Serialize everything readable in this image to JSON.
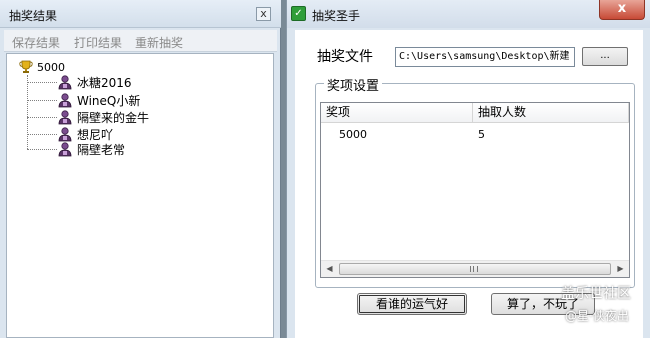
{
  "left_window": {
    "title": "抽奖结果",
    "close_label": "x",
    "menu": [
      "保存结果",
      "打印结果",
      "重新抽奖"
    ],
    "tree": {
      "root": "5000",
      "root_icon": "trophy-icon",
      "children": [
        "冰糖2016",
        "WineQ小新",
        "隔壁来的金牛",
        "想尼吖",
        "隔壁老常"
      ],
      "child_icon": "user-icon"
    }
  },
  "right_window": {
    "title": "抽奖圣手",
    "close_label": "x",
    "file_label": "抽奖文件",
    "file_path": "C:\\Users\\samsung\\Desktop\\新建",
    "browse_label": "...",
    "group_title": "奖项设置",
    "table": {
      "headers": [
        "奖项",
        "抽取人数"
      ],
      "rows": [
        [
          "5000",
          "5"
        ]
      ]
    },
    "buttons": {
      "lucky": "看谁的运气好",
      "quit": "算了，不玩了"
    }
  },
  "watermark": {
    "main": "盖乐世社区",
    "sub": "@星·侠夜出"
  },
  "colors": {
    "window_bg": "#dbe5ef",
    "close_button": "#c74a36",
    "app_icon": "#2f9e3a"
  }
}
